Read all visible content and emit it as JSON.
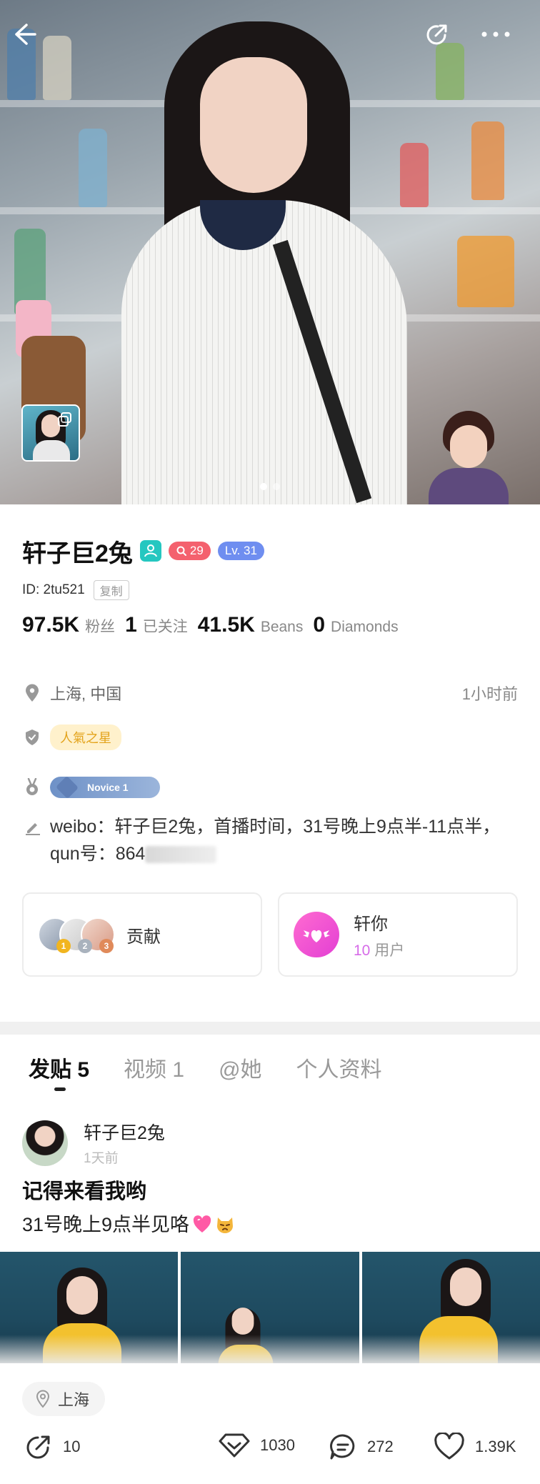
{
  "profile": {
    "name": "轩子巨2兔",
    "search_badge": "29",
    "level": "Lv. 31",
    "id_text": "ID: 2tu521",
    "copy_label": "复制",
    "stats": {
      "fans_value": "97.5K",
      "fans_label": "粉丝",
      "following_value": "1",
      "following_label": "已关注",
      "beans_value": "41.5K",
      "beans_label": "Beans",
      "diamonds_value": "0",
      "diamonds_label": "Diamonds"
    },
    "location": "上海, 中国",
    "last_active": "1小时前",
    "tag": "人氣之星",
    "medal_label": "Novice 1",
    "bio": "weibo：轩子巨2兔，首播时间，31号晚上9点半-11点半，qun号：864"
  },
  "cards": {
    "contribution_label": "贡献",
    "ranks": [
      "1",
      "2",
      "3"
    ],
    "fan_group_name": "轩你",
    "fan_count": "10",
    "fan_unit": "用户"
  },
  "tabs": [
    {
      "label": "发贴 5"
    },
    {
      "label": "视频 1"
    },
    {
      "label": "@她"
    },
    {
      "label": "个人资料"
    }
  ],
  "post": {
    "author": "轩子巨2兔",
    "time": "1天前",
    "title": "记得来看我哟",
    "text": "31号晚上9点半见咯",
    "location": "上海",
    "shares": "10",
    "gifts": "1030",
    "comments": "272",
    "likes": "1.39K"
  },
  "colors": {
    "accent_pink": "#e33fd4",
    "badge_red": "#f4616e",
    "badge_blue": "#6f8ef0",
    "verified_teal": "#25c7c0",
    "tag_yellow": "#e3a31b"
  },
  "icons": [
    "back-arrow-icon",
    "share-icon",
    "more-icon",
    "copy-icon",
    "verified-icon",
    "search-icon",
    "location-pin-icon",
    "shield-icon",
    "medal-icon",
    "edit-pencil-icon",
    "heart-wings-icon",
    "gift-diamond-icon",
    "comment-icon",
    "like-heart-icon"
  ]
}
